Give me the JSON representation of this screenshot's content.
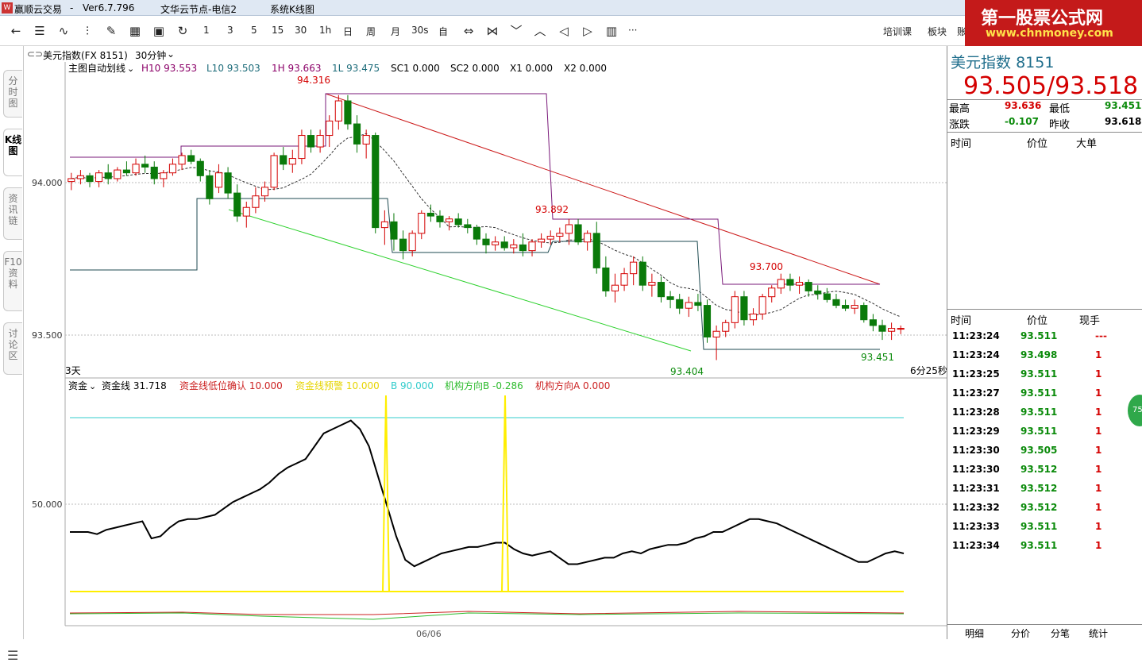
{
  "titlebar": {
    "app": "赢顺云交易",
    "sep": "-",
    "version": "Ver6.7.796",
    "server": "文华云节点-电信2",
    "template": "系统K线图"
  },
  "watermark": {
    "line1": "第一股票公式网",
    "line2": "www.chnmoney.com"
  },
  "toolbar": {
    "icons": [
      "back-arrow-icon",
      "list-icon",
      "trend-icon",
      "candle-icon",
      "draw-icon",
      "grid-icon",
      "save-icon",
      "refresh-icon"
    ],
    "periods": [
      "1",
      "3",
      "5",
      "15",
      "30",
      "1h",
      "日",
      "周",
      "月",
      "30s",
      "自"
    ],
    "right_links": [
      "培训课",
      "板块",
      "账"
    ],
    "more": "···"
  },
  "left_tabs": [
    "分时图",
    "K线图",
    "资讯链",
    "F10资料",
    "讨论区"
  ],
  "chart_header": {
    "symbol": "美元指数(FX 8151)",
    "period": "30分钟",
    "indicator": "主图自动划线",
    "h10": "H10 93.553",
    "l10": "L10 93.503",
    "h1": "1H 93.663",
    "l1": "1L 93.475",
    "sc1": "SC1 0.000",
    "sc2": "SC2 0.000",
    "x1": "X1 0.000",
    "x2": "X2 0.000"
  },
  "main_chart": {
    "y_ticks": [
      "94.000",
      "93.500"
    ],
    "labels": {
      "high1": "94.316",
      "high2": "93.892",
      "high3": "93.700",
      "low1": "93.404",
      "low2": "93.451"
    },
    "left_note": "3天",
    "right_note": "6分25秒"
  },
  "sub_chart": {
    "indicator": "资金",
    "line": "资金线 31.718",
    "confirm": "资金线低位确认 10.000",
    "warn": "资金线预警 10.000",
    "b": "B 90.000",
    "dirB": "机构方向B -0.286",
    "dirA": "机构方向A 0.000",
    "y_tick": "50.000",
    "x_label": "06/06",
    "colors": {
      "money_line": "#000000",
      "warn": "#ffff00",
      "b_line": "#33cccc",
      "dirB": "#2dbb2d",
      "dirA": "#cc2222"
    }
  },
  "chart_data": {
    "type": "candlestick",
    "y_range": [
      93.36,
      94.38
    ],
    "ohlc": [
      [
        94.02,
        94.05,
        93.99,
        94.03
      ],
      [
        94.03,
        94.06,
        94.01,
        94.04
      ],
      [
        94.04,
        94.05,
        94.0,
        94.02
      ],
      [
        94.02,
        94.06,
        94.0,
        94.05
      ],
      [
        94.05,
        94.08,
        94.01,
        94.03
      ],
      [
        94.03,
        94.07,
        94.02,
        94.06
      ],
      [
        94.06,
        94.09,
        94.04,
        94.05
      ],
      [
        94.05,
        94.1,
        94.04,
        94.08
      ],
      [
        94.08,
        94.11,
        94.05,
        94.07
      ],
      [
        94.07,
        94.09,
        94.01,
        94.03
      ],
      [
        94.03,
        94.06,
        94.0,
        94.05
      ],
      [
        94.05,
        94.1,
        94.04,
        94.08
      ],
      [
        94.08,
        94.12,
        94.06,
        94.11
      ],
      [
        94.11,
        94.13,
        94.08,
        94.09
      ],
      [
        94.09,
        94.1,
        94.02,
        94.04
      ],
      [
        94.04,
        94.06,
        93.94,
        93.96
      ],
      [
        94.0,
        94.08,
        93.98,
        94.05
      ],
      [
        94.05,
        94.07,
        93.96,
        93.98
      ],
      [
        93.98,
        94.01,
        93.88,
        93.9
      ],
      [
        93.9,
        93.95,
        93.86,
        93.93
      ],
      [
        93.93,
        94.0,
        93.91,
        93.97
      ],
      [
        93.97,
        94.02,
        93.95,
        94.0
      ],
      [
        94.0,
        94.12,
        93.99,
        94.11
      ],
      [
        94.11,
        94.14,
        94.06,
        94.08
      ],
      [
        94.08,
        94.13,
        94.05,
        94.1
      ],
      [
        94.1,
        94.2,
        94.08,
        94.18
      ],
      [
        94.18,
        94.2,
        94.12,
        94.14
      ],
      [
        94.14,
        94.2,
        94.12,
        94.18
      ],
      [
        94.18,
        94.25,
        94.14,
        94.23
      ],
      [
        94.23,
        94.32,
        94.2,
        94.3
      ],
      [
        94.3,
        94.32,
        94.2,
        94.22
      ],
      [
        94.22,
        94.25,
        94.12,
        94.15
      ],
      [
        94.15,
        94.2,
        94.1,
        94.18
      ],
      [
        94.18,
        94.19,
        93.84,
        93.86
      ],
      [
        93.86,
        93.92,
        93.8,
        93.88
      ],
      [
        93.88,
        93.91,
        93.78,
        93.82
      ],
      [
        93.82,
        93.85,
        93.75,
        93.78
      ],
      [
        93.78,
        93.85,
        93.76,
        93.84
      ],
      [
        93.84,
        93.92,
        93.82,
        93.91
      ],
      [
        93.91,
        93.94,
        93.88,
        93.9
      ],
      [
        93.9,
        93.92,
        93.86,
        93.88
      ],
      [
        93.88,
        93.9,
        93.85,
        93.89
      ],
      [
        93.89,
        93.91,
        93.86,
        93.87
      ],
      [
        93.87,
        93.89,
        93.84,
        93.86
      ],
      [
        93.86,
        93.87,
        93.8,
        93.82
      ],
      [
        93.82,
        93.84,
        93.77,
        93.8
      ],
      [
        93.8,
        93.83,
        93.78,
        93.81
      ],
      [
        93.81,
        93.83,
        93.78,
        93.79
      ],
      [
        93.79,
        93.82,
        93.77,
        93.8
      ],
      [
        93.8,
        93.84,
        93.76,
        93.78
      ],
      [
        93.78,
        93.82,
        93.76,
        93.81
      ],
      [
        93.81,
        93.84,
        93.79,
        93.82
      ],
      [
        93.82,
        93.85,
        93.8,
        93.83
      ],
      [
        93.83,
        93.86,
        93.81,
        93.84
      ],
      [
        93.84,
        93.89,
        93.8,
        93.87
      ],
      [
        93.87,
        93.89,
        93.8,
        93.81
      ],
      [
        93.81,
        93.85,
        93.78,
        93.84
      ],
      [
        93.84,
        93.88,
        93.7,
        93.72
      ],
      [
        93.72,
        93.76,
        93.62,
        93.64
      ],
      [
        93.64,
        93.7,
        93.6,
        93.66
      ],
      [
        93.66,
        93.72,
        93.64,
        93.7
      ],
      [
        93.7,
        93.76,
        93.66,
        93.74
      ],
      [
        93.74,
        93.76,
        93.64,
        93.66
      ],
      [
        93.66,
        93.7,
        93.62,
        93.67
      ],
      [
        93.67,
        93.69,
        93.6,
        93.62
      ],
      [
        93.62,
        93.64,
        93.58,
        93.61
      ],
      [
        93.61,
        93.63,
        93.56,
        93.58
      ],
      [
        93.58,
        93.62,
        93.55,
        93.6
      ],
      [
        93.6,
        93.63,
        93.57,
        93.59
      ],
      [
        93.59,
        93.61,
        93.46,
        93.48
      ],
      [
        93.48,
        93.52,
        93.4,
        93.5
      ],
      [
        93.5,
        93.54,
        93.48,
        93.53
      ],
      [
        93.53,
        93.64,
        93.51,
        93.62
      ],
      [
        93.62,
        93.64,
        93.52,
        93.54
      ],
      [
        93.54,
        93.58,
        93.52,
        93.56
      ],
      [
        93.56,
        93.63,
        93.54,
        93.62
      ],
      [
        93.62,
        93.66,
        93.6,
        93.65
      ],
      [
        93.65,
        93.7,
        93.63,
        93.68
      ],
      [
        93.68,
        93.7,
        93.64,
        93.66
      ],
      [
        93.66,
        93.69,
        93.63,
        93.67
      ],
      [
        93.67,
        93.68,
        93.62,
        93.64
      ],
      [
        93.64,
        93.66,
        93.61,
        93.63
      ],
      [
        93.63,
        93.65,
        93.6,
        93.61
      ],
      [
        93.61,
        93.63,
        93.58,
        93.59
      ],
      [
        93.59,
        93.61,
        93.57,
        93.58
      ],
      [
        93.58,
        93.61,
        93.56,
        93.59
      ],
      [
        93.59,
        93.6,
        93.53,
        93.54
      ],
      [
        93.54,
        93.56,
        93.5,
        93.52
      ],
      [
        93.52,
        93.54,
        93.47,
        93.5
      ],
      [
        93.5,
        93.53,
        93.47,
        93.51
      ],
      [
        93.51,
        93.52,
        93.49,
        93.51
      ]
    ],
    "money_line": [
      60,
      60,
      60,
      61,
      59,
      58,
      57,
      56,
      55,
      63,
      62,
      58,
      55,
      54,
      54,
      53,
      52,
      49,
      46,
      44,
      42,
      40,
      37,
      33,
      30,
      28,
      26,
      20,
      14,
      12,
      10,
      8,
      12,
      20,
      34,
      48,
      62,
      73,
      76,
      74,
      72,
      70,
      69,
      68,
      67,
      67,
      66,
      65,
      65,
      68,
      70,
      71,
      70,
      69,
      72,
      75,
      75,
      74,
      73,
      72,
      72,
      70,
      69,
      70,
      68,
      67,
      66,
      66,
      65,
      63,
      62,
      60,
      60,
      58,
      56,
      54,
      54,
      55,
      56,
      58,
      60,
      62,
      64,
      66,
      68,
      70,
      72,
      74,
      74,
      72,
      70,
      69,
      70
    ]
  },
  "right_panel": {
    "name": "美元指数",
    "code": "8151",
    "price": "93.505/93.518",
    "high_label": "最高",
    "high": "93.636",
    "low_label": "最低",
    "low": "93.451",
    "chg_label": "涨跌",
    "chg": "-0.107",
    "prev_label": "昨收",
    "prev": "93.618",
    "big_hdr": [
      "时间",
      "价位",
      "大单"
    ],
    "tick_hdr": [
      "时间",
      "价位",
      "现手"
    ],
    "ticks": [
      {
        "time": "11:23:24",
        "price": "93.511",
        "vol": "---"
      },
      {
        "time": "11:23:24",
        "price": "93.498",
        "vol": "1"
      },
      {
        "time": "11:23:25",
        "price": "93.511",
        "vol": "1"
      },
      {
        "time": "11:23:27",
        "price": "93.511",
        "vol": "1"
      },
      {
        "time": "11:23:28",
        "price": "93.511",
        "vol": "1"
      },
      {
        "time": "11:23:29",
        "price": "93.511",
        "vol": "1"
      },
      {
        "time": "11:23:30",
        "price": "93.505",
        "vol": "1"
      },
      {
        "time": "11:23:30",
        "price": "93.512",
        "vol": "1"
      },
      {
        "time": "11:23:31",
        "price": "93.512",
        "vol": "1"
      },
      {
        "time": "11:23:32",
        "price": "93.512",
        "vol": "1"
      },
      {
        "time": "11:23:33",
        "price": "93.511",
        "vol": "1"
      },
      {
        "time": "11:23:34",
        "price": "93.511",
        "vol": "1"
      }
    ],
    "bottom_tabs": [
      "明细",
      "分价",
      "分笔",
      "统计"
    ],
    "badge": "75"
  }
}
